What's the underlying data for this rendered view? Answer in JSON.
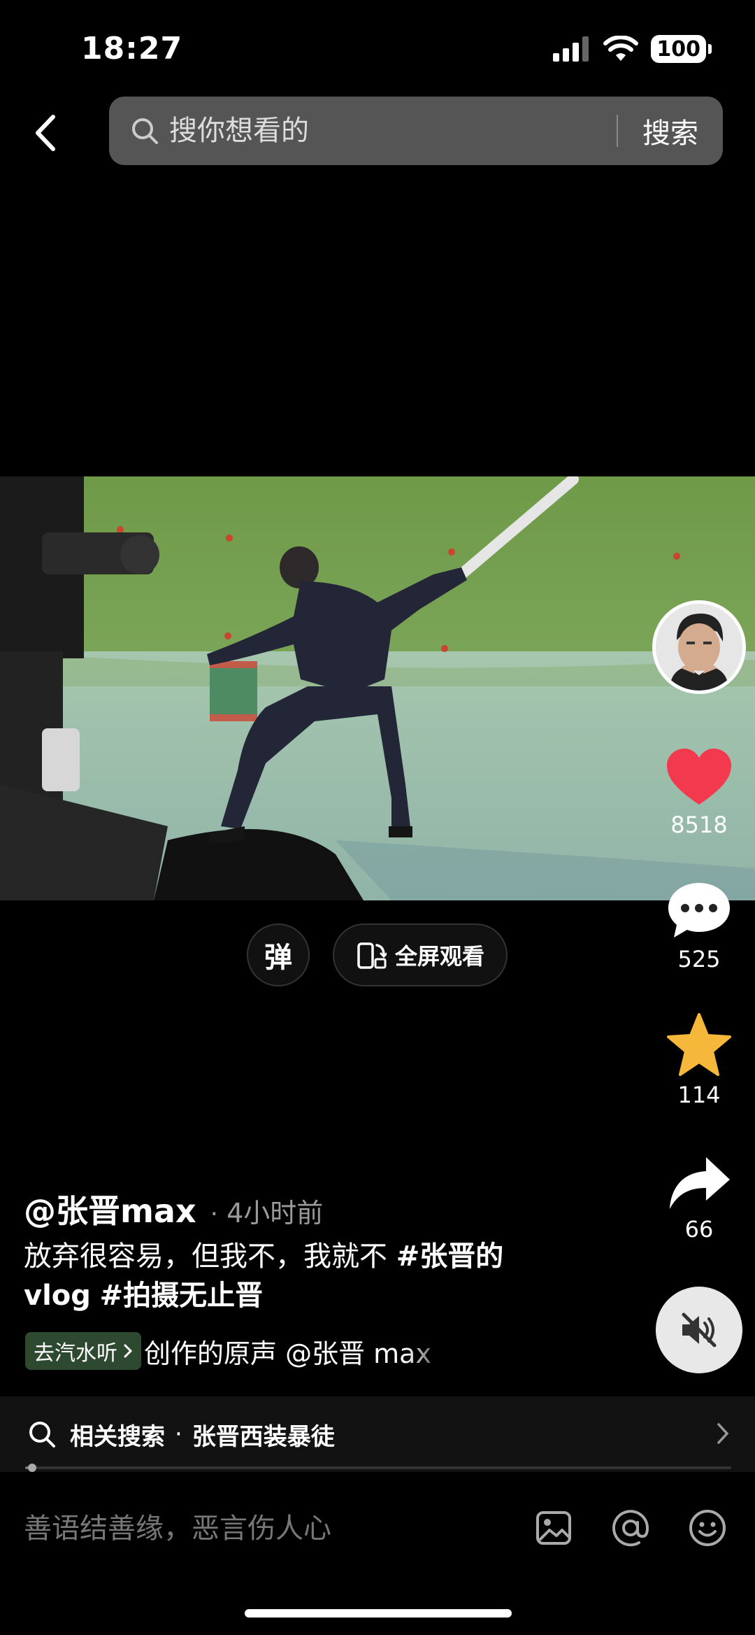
{
  "status_bar": {
    "time": "18:27",
    "battery": "100"
  },
  "search": {
    "placeholder": "搜你想看的",
    "button_label": "搜索"
  },
  "video": {
    "danmu_label": "弹",
    "fullscreen_label": "全屏观看"
  },
  "actions": {
    "likes": "8518",
    "comments": "525",
    "favorites": "114",
    "shares": "66"
  },
  "post": {
    "author": "@张晋max",
    "time_ago": "4小时前",
    "description_text": "放弃很容易，但我不，我就不 ",
    "tags": [
      "#张晋的vlog",
      "#拍摄无止晋"
    ],
    "go_listen_label": "去汽水听",
    "music_text": "创作的原声   @张晋 max"
  },
  "related_search": {
    "label": "相关搜索",
    "separator": "·",
    "query": "张晋西装暴徒"
  },
  "playback": {
    "progress": 0.01
  },
  "comment_bar": {
    "placeholder": "善语结善缘，恶言伤人心"
  },
  "colors": {
    "like": "#f2394e",
    "favorite": "#f6b83a",
    "go_listen_bg": "#2d4a30"
  }
}
